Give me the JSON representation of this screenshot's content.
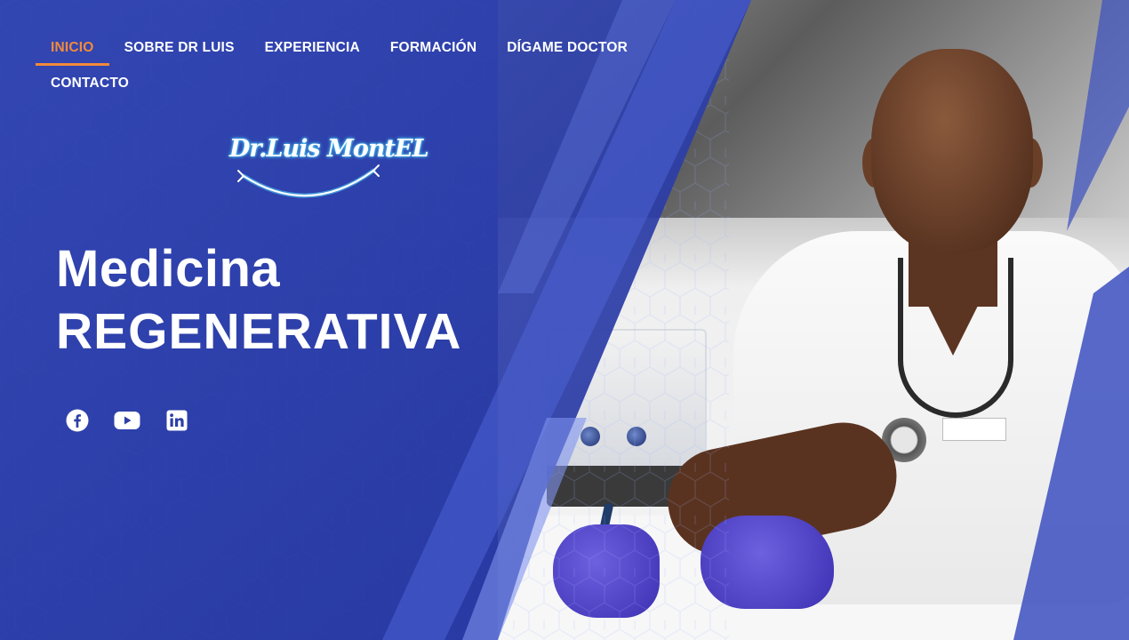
{
  "nav": {
    "items": [
      {
        "label": "INICIO",
        "active": true
      },
      {
        "label": "SOBRE DR LUIS",
        "active": false
      },
      {
        "label": "EXPERIENCIA",
        "active": false
      },
      {
        "label": "FORMACIÓN",
        "active": false
      },
      {
        "label": "DÍGAME DOCTOR",
        "active": false
      },
      {
        "label": "CONTACTO",
        "active": false
      }
    ]
  },
  "logo": {
    "text": "Dr.Luis MontEL"
  },
  "hero": {
    "title_line1": "Medicina",
    "title_line2": "REGENERATIVA"
  },
  "socials": [
    {
      "name": "facebook",
      "icon": "facebook-icon"
    },
    {
      "name": "youtube",
      "icon": "youtube-icon"
    },
    {
      "name": "linkedin",
      "icon": "linkedin-icon"
    }
  ],
  "colors": {
    "brand_blue": "#2d3fa6",
    "accent_orange": "#f28a3b",
    "logo_glow": "#4fd6ff",
    "text": "#ffffff"
  }
}
